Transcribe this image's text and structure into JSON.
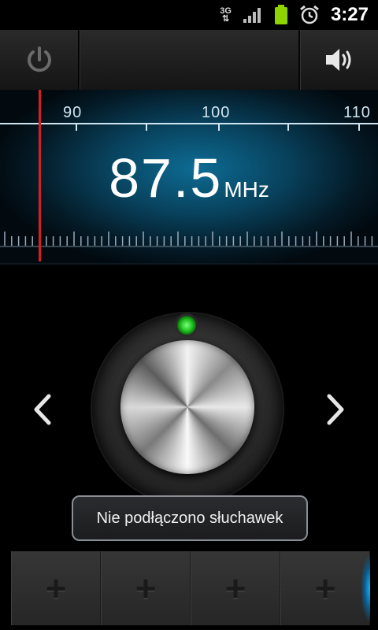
{
  "status_bar": {
    "network": "3G",
    "time": "3:27",
    "icons": [
      "3g-data-icon",
      "signal-icon",
      "battery-icon",
      "alarm-icon"
    ]
  },
  "toolbar": {
    "power_icon": "power-icon",
    "speaker_icon": "speaker-icon"
  },
  "tuner": {
    "scale_labels": [
      "90",
      "100",
      "110"
    ],
    "frequency": "87.5",
    "unit": "MHz",
    "needle_color": "#d81f1f"
  },
  "controls": {
    "prev_icon": "chevron-left-icon",
    "next_icon": "chevron-right-icon",
    "knob_led_color": "#33dd33"
  },
  "toast": {
    "message": "Nie podłączono słuchawek"
  },
  "presets": {
    "slots": [
      "+",
      "+",
      "+",
      "+"
    ]
  }
}
